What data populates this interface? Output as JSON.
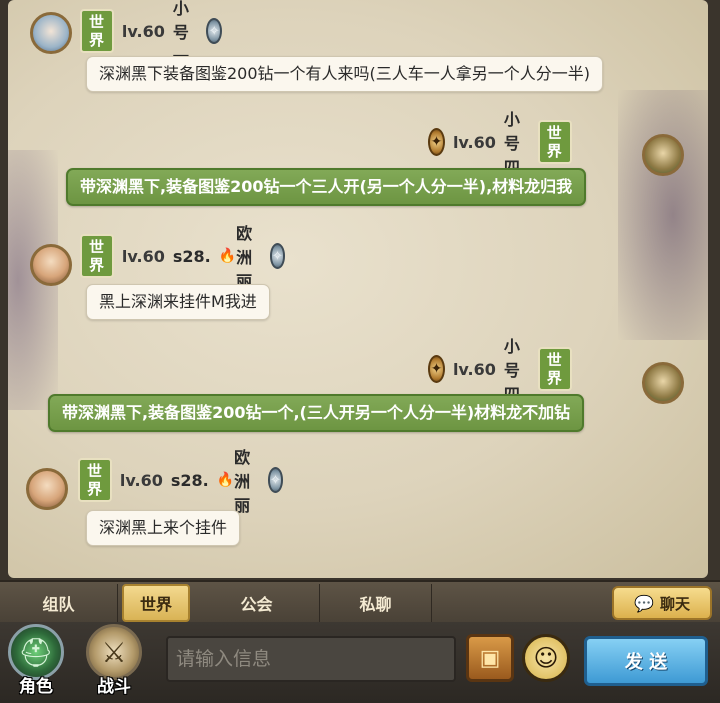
{
  "messages": [
    {
      "side": "left",
      "channel": "世界",
      "level": "lv.60",
      "server": "",
      "name": "小号一",
      "text": "深渊黑下装备图鉴200钻一个有人来吗(三人车一人拿另一个人分一半)"
    },
    {
      "side": "right",
      "channel": "世界",
      "level": "lv.60",
      "server": "",
      "name": "小号四",
      "text": "带深渊黑下,装备图鉴200钻一个三人开(另一个人分一半),材料龙归我"
    },
    {
      "side": "left",
      "channel": "世界",
      "level": "lv.60",
      "server": "s28.",
      "name": "欧洲丽",
      "text": "黑上深渊来挂件M我进"
    },
    {
      "side": "right",
      "channel": "世界",
      "level": "lv.60",
      "server": "",
      "name": "小号四",
      "text": "带深渊黑下,装备图鉴200钻一个,(三人开另一个人分一半)材料龙不加钻"
    },
    {
      "side": "left",
      "channel": "世界",
      "level": "lv.60",
      "server": "s28.",
      "name": "欧洲丽",
      "text": "深渊黑上来个挂件"
    }
  ],
  "tabs": [
    {
      "label": "组队",
      "active": false
    },
    {
      "label": "世界",
      "active": true
    },
    {
      "label": "公会",
      "active": false
    },
    {
      "label": "私聊",
      "active": false
    }
  ],
  "chat_toggle_label": "聊天",
  "side_buttons": {
    "role_label": "角色",
    "battle_label": "战斗"
  },
  "input": {
    "placeholder": "请输入信息",
    "value": ""
  },
  "send_label": "发 送",
  "icons": {
    "emblem": "crystal-emblem-icon",
    "emblem_gold": "gold-emblem-icon",
    "fire": "fire-icon",
    "chat": "chat-bubble-icon",
    "chest": "treasure-chest-icon",
    "emoji": "emoji-face-icon"
  },
  "colors": {
    "world_tag": "#6f9a3e",
    "own_bubble": "#6d9542",
    "send_button": "#3e9ad4"
  }
}
